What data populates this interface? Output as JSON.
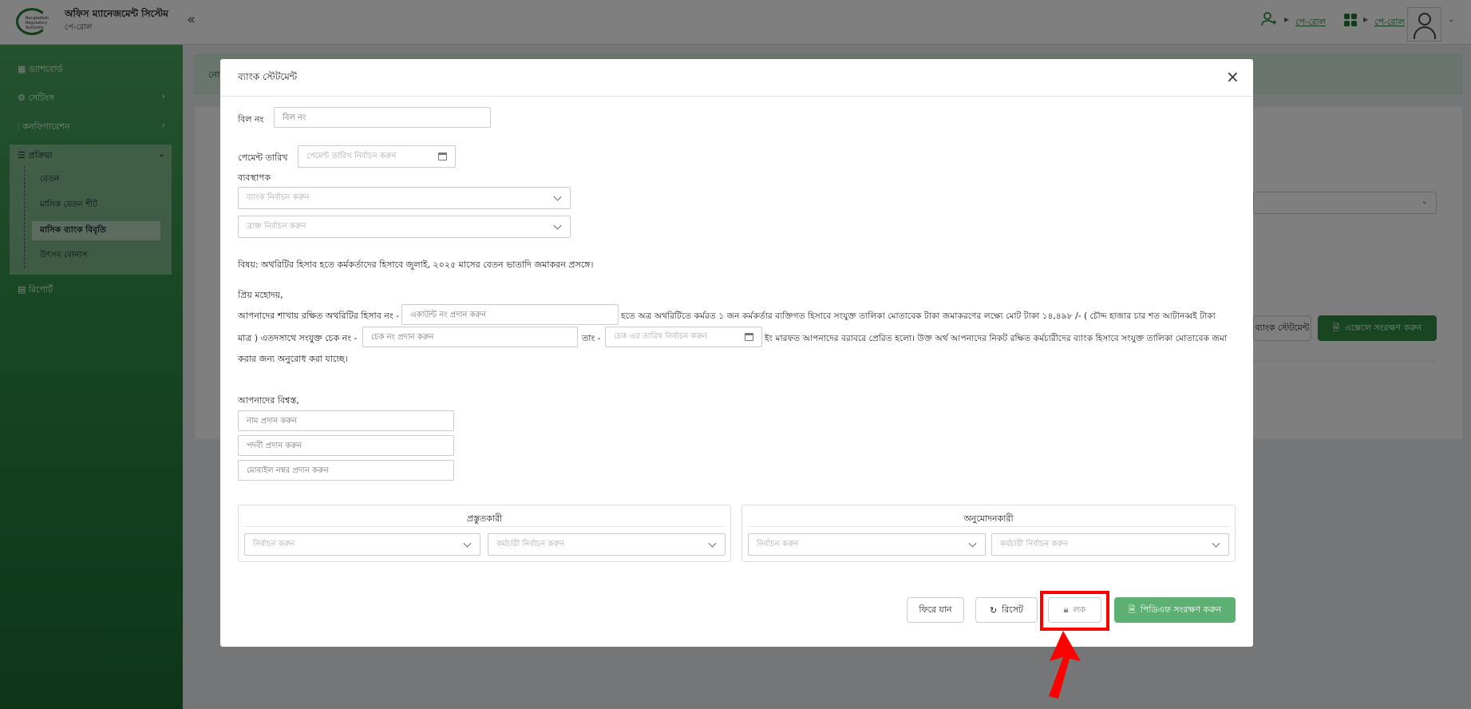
{
  "header": {
    "logo_text": "Bangladesh Regulatory Authority",
    "app_title": "অফিস ম্যানেজমেন্ট সিস্টেম",
    "app_subtitle": "পে-রোল",
    "collapse_icon": "«",
    "link_user": "পে-রোল",
    "link_apps": "পে-রোল"
  },
  "sidebar": {
    "items": [
      {
        "label": "ড্যাশবোর্ড"
      },
      {
        "label": "সেটিংস"
      },
      {
        "label": "কনফিগারেশন"
      },
      {
        "label": "প্রক্রিয়া"
      },
      {
        "label": "রিপোর্ট"
      }
    ],
    "sub_items": [
      {
        "label": "বেতন"
      },
      {
        "label": "মাসিক বেতন শীট"
      },
      {
        "label": "মাসিক ব্যাংক বিবৃতি"
      },
      {
        "label": "উৎসব বোনাস"
      }
    ]
  },
  "background": {
    "btn_statement": "ব্যাংক স্টেটমেন্ট",
    "btn_excel": "এক্সেলে সংরক্ষণ করুন",
    "alert_text": "নোট"
  },
  "modal": {
    "title": "ব্যাংক স্টেটমেন্ট",
    "close": "×",
    "bill_label": "বিল নং",
    "bill_placeholder": "বিল নং",
    "payment_date_label": "পেমেন্ট তারিখ",
    "payment_date_placeholder": "পেমেন্ট তারিখ নির্বাচন করুন",
    "manager_label": "ব্যবস্থাপক",
    "bank_placeholder": "ব্যাংক নির্বাচন করুন",
    "branch_placeholder": "ব্রাঞ্চ নির্বাচন করুন",
    "subject": "বিষয়: অথরিটির হিসাব হতে কর্মকর্তাদের হিসাবে জুলাই, ২০২৫ মাসের বেতন ভাতাদি জমাকরন প্রসঙ্গে।",
    "salutation": "প্রিয় মহোদয়,",
    "line1_a": "আপনাদের শাখায় রক্ষিত অথরিটির হিসাব নং -",
    "account_placeholder": "একাউন্ট নং প্রদান করুন",
    "line1_b": "হতে অত্র অথরিটিতে কর্মরত ১ জন কর্মকর্তার ব্যক্তিগত হিসাবে সংযুক্ত তালিকা মোতাবেক টাকা জমাকরণের লক্ষ্যে মোট টাকা ১৪,৪৯৮ /- ( চৌদ্দ হাজার চার শত আটানব্বই টাকা",
    "line2_a": "মাত্র ) এতদসাথে সংযুক্ত চেক নং -",
    "cheque_placeholder": "চেক নং প্রদান করুন",
    "line2_b": "তাং -",
    "cheque_date_placeholder": "চেক এর তারিখ নির্বাচন করুন",
    "line2_c": "ইং মারফত আপনাদের বরাবরে প্রেরিত হলো। উক্ত অর্থ আপনাদের নিকট রক্ষিত কর্মচারীদের ব্যাংক হিসাবে সংযুক্ত তালিকা মোতাবেক জমা",
    "line3": "করার জন্য অনুরোধ করা যাচ্ছে।",
    "closing": "আপনাদের বিশ্বস্ত,",
    "name_placeholder": "নাম প্রদান করুন",
    "designation_placeholder": "পদবী প্রদান করুন",
    "mobile_placeholder": "মোবাইল নম্বর প্রদান করুন",
    "preparer_title": "প্রস্তুতকারী",
    "approver_title": "অনুমোদনকারী",
    "select_placeholder": "নির্বাচন করুন",
    "employee_placeholder": "কর্মচারী নির্বাচন করুন",
    "btn_back": "ফিরে যান",
    "btn_reset": "রিসেট",
    "btn_lock": "লক",
    "btn_pdf": "পিডিএফ সংরক্ষণ করুন"
  },
  "colors": {
    "brand_green": "#1e7a34",
    "pdf_button": "#5cb072",
    "highlight": "#ff0000"
  }
}
